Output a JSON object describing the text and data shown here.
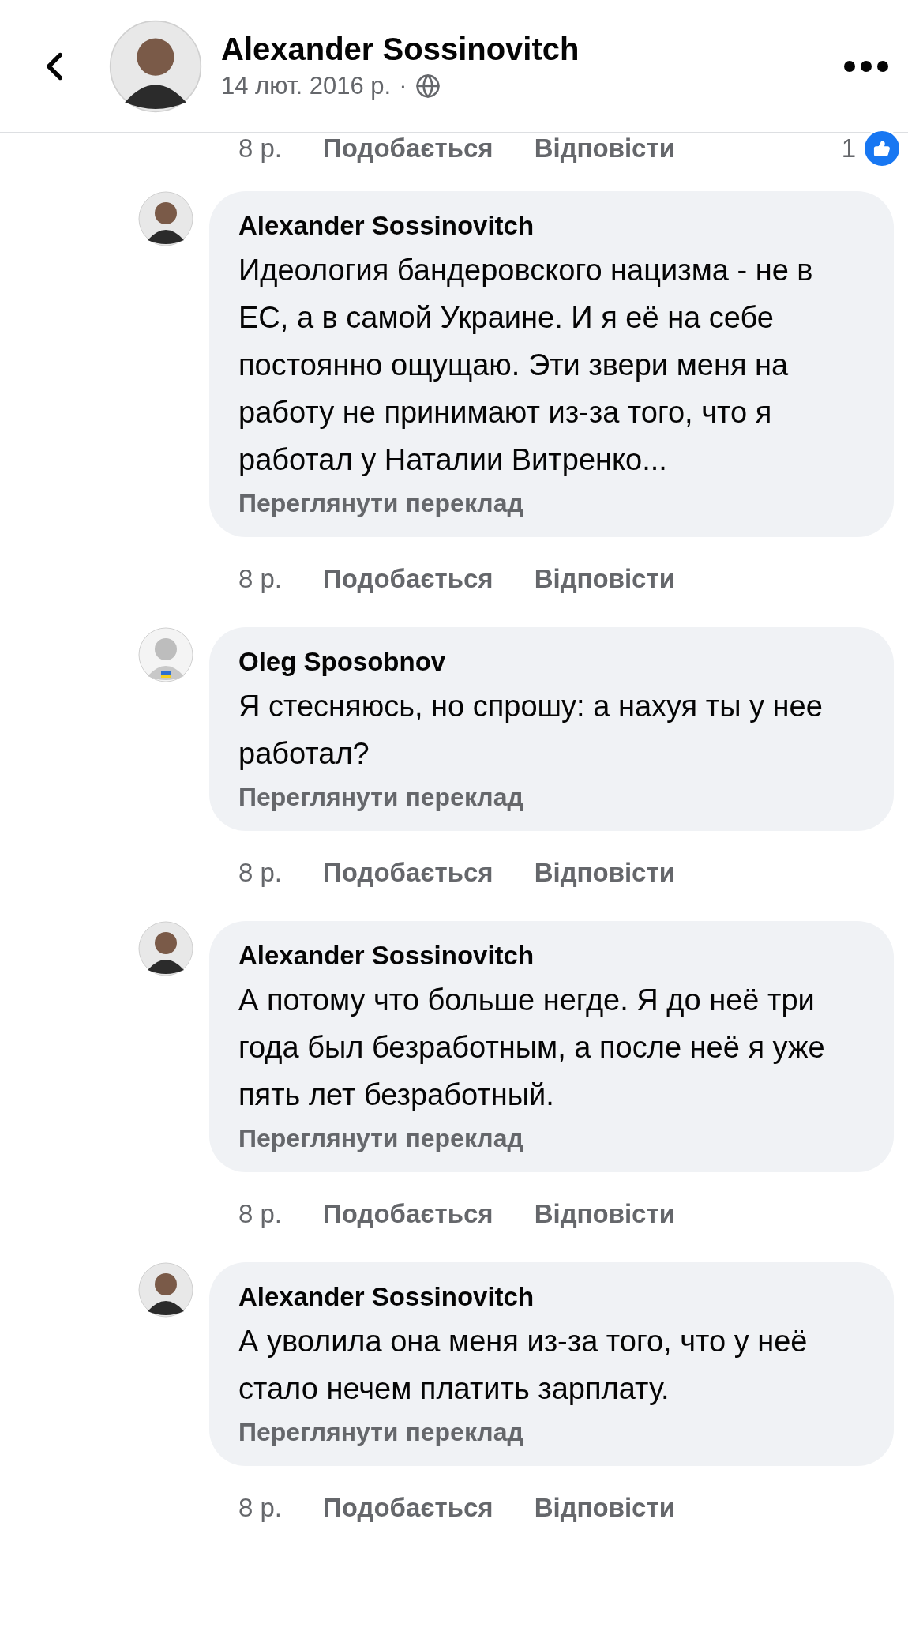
{
  "header": {
    "author": "Alexander Sossinovitch",
    "date": "14 лют. 2016 р.",
    "separator": "·"
  },
  "previous_actions": {
    "time": "8 р.",
    "like": "Подобається",
    "reply": "Відповісти",
    "reaction_count": "1"
  },
  "comments": [
    {
      "author": "Alexander Sossinovitch",
      "kind": "man",
      "text": "Идеология бандеровского нацизма - не в ЕС, а в самой Украине. И я её на себе постоянно ощущаю. Эти звери меня на работу не принимают из-за того, что я работал у Наталии Витренко...",
      "translate": "Переглянути переклад",
      "time": "8 р.",
      "like": "Подобається",
      "reply": "Відповісти"
    },
    {
      "author": "Oleg Sposobnov",
      "kind": "sketch",
      "text": "Я стесняюсь, но спрошу: а нахуя ты у нее работал?",
      "translate": "Переглянути переклад",
      "time": "8 р.",
      "like": "Подобається",
      "reply": "Відповісти"
    },
    {
      "author": "Alexander Sossinovitch",
      "kind": "man",
      "text": "А потому что больше негде. Я до неё три года был безработным, а после неё я уже пять лет безработный.",
      "translate": "Переглянути переклад",
      "time": "8 р.",
      "like": "Подобається",
      "reply": "Відповісти"
    },
    {
      "author": "Alexander Sossinovitch",
      "kind": "man",
      "text": "А уволила она меня из-за того, что у неё стало нечем платить зарплату.",
      "translate": "Переглянути переклад",
      "time": "8 р.",
      "like": "Подобається",
      "reply": "Відповісти"
    }
  ]
}
